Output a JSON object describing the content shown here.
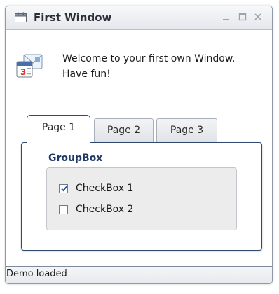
{
  "window": {
    "title": "First Window",
    "icon": "calendar-icon",
    "controls": [
      "minimize-icon",
      "maximize-icon",
      "close-icon"
    ]
  },
  "welcome": {
    "icon": "calendar-mail-icon",
    "line1": "Welcome to your first own Window.",
    "line2": "Have fun!"
  },
  "tabs": [
    {
      "label": "Page 1",
      "selected": true
    },
    {
      "label": "Page 2",
      "selected": false
    },
    {
      "label": "Page 3",
      "selected": false
    }
  ],
  "groupbox": {
    "legend": "GroupBox",
    "checkboxes": [
      {
        "label": "CheckBox 1",
        "checked": true
      },
      {
        "label": "CheckBox 2",
        "checked": false
      }
    ]
  },
  "status": {
    "text": "Demo loaded"
  },
  "colors": {
    "accent": "#1f3a66",
    "tab_border": "#2f4a6e"
  }
}
